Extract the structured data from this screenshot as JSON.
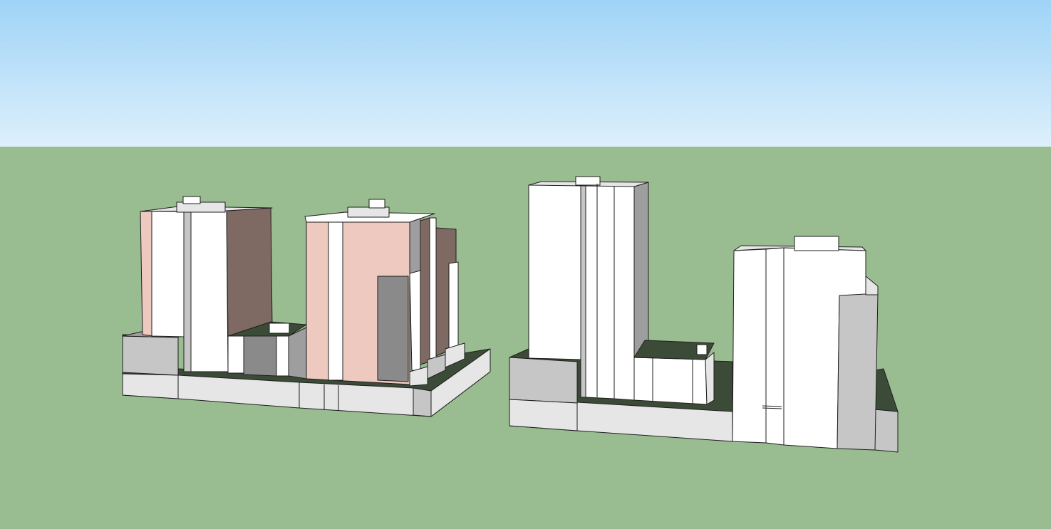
{
  "viewport": {
    "sky_top_color": "#9fd3f7",
    "sky_bottom_color": "#ddf0fb",
    "ground_color": "#99bc90",
    "edge_color": "#1e1e1e"
  },
  "materials": {
    "white": "#ffffff",
    "light_gray": "#e6e6e6",
    "mid_gray": "#c6c6c6",
    "gray": "#9e9e9e",
    "dark_gray": "#8a8a8a",
    "pink": "#edc9bf",
    "brown": "#7f6963",
    "dark_green": "#3c4b37"
  },
  "models": [
    {
      "id": "left-block",
      "description": ""
    },
    {
      "id": "right-block",
      "description": ""
    }
  ]
}
